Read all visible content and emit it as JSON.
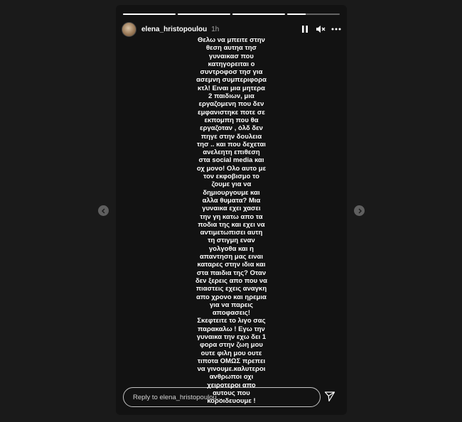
{
  "story": {
    "progress": [
      1,
      1,
      1,
      0.35
    ],
    "username": "elena_hristopoulou",
    "time": "1h",
    "controls": {
      "pause_icon": "pause-icon",
      "mute_icon": "speaker-muted-icon",
      "more_icon": "more-horizontal-icon"
    },
    "text_lines": [
      "Θελω να μπειτε στην",
      "θεση αυτηα τησ",
      "γυναικασ που",
      "κατηγορειται ο",
      "συντροφοσ τησ για",
      "ασεμνη συμπεριφορα",
      "κτλ! Ειναι μια μητερα",
      "2 παιδιων, μια",
      "εργαζομενη που δεν",
      "εμφανιστηκε ποτε σε",
      "εκπομπη που θα",
      "εργαζοταν , όλδ δεν",
      "πηγε στην δουλεια",
      "τησ .. και που δεχεται",
      "ανελεητη επιθεση",
      "στα social media και",
      "οχ μονο! Ολο αυτο με",
      "τον εκφοβισμο το",
      "ζουμε για να",
      "δημιουργουμε και",
      "αλλα θυματα? Μια",
      "γυναικα εχει χασει",
      "την γη κατω απο τα",
      "ποδια της και εχει να",
      "αντιμετωπισει αυτη",
      "τη στιγμη εναν",
      "γολγοθα και η",
      "απαντηση μας ειναι",
      "καταρες στην ιδια και",
      "στα παιδια της? Οταν",
      "δεν ξερεις απο που να",
      "πιαστεις εχεις αναγκη",
      "απο χρονο και ηρεμια",
      "για να παρεις",
      "αποφασεις!",
      "Σκεφτειτε το λιγο σας",
      "παρακαλω ! Εγω την",
      "γυναικα την εχω δει 1",
      "φορα στην ζωη μου",
      "ουτε φιλη μου ουτε",
      "τιποτα ΟΜΩΣ πρεπει",
      "να γινουμε.καλυτεροι",
      "ανθρωποι οχι",
      "χειροτεροι απο",
      "αυτους που",
      "κοροιδευουμε !"
    ],
    "reply_placeholder": "Reply to elena_hristopoulou...",
    "send_icon": "send-icon"
  },
  "nav": {
    "prev_icon": "chevron-left-icon",
    "next_icon": "chevron-right-icon"
  }
}
